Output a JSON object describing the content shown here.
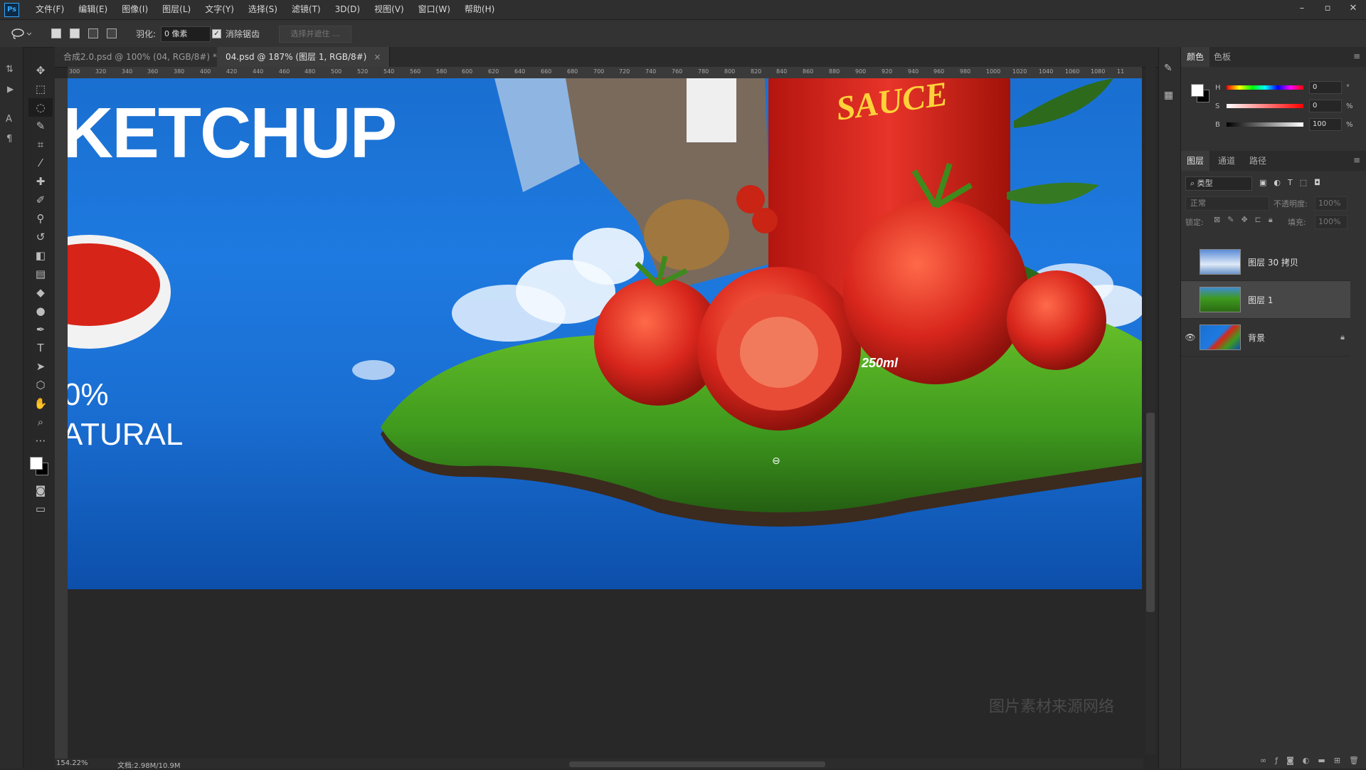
{
  "app": {
    "logo": "Ps"
  },
  "menu": [
    "文件(F)",
    "编辑(E)",
    "图像(I)",
    "图层(L)",
    "文字(Y)",
    "选择(S)",
    "滤镜(T)",
    "3D(D)",
    "视图(V)",
    "窗口(W)",
    "帮助(H)"
  ],
  "window_controls": {
    "minimize": "–",
    "restore": "▫",
    "close": "✕"
  },
  "options": {
    "feather_label": "羽化:",
    "feather_value": "0 像素",
    "antialias_label": "消除锯齿",
    "antialias_checked": true,
    "select_mask_label": "选择并遮住 ..."
  },
  "tabs": [
    {
      "label": "合成2.0.psd @ 100% (04, RGB/8#) *",
      "close": "×",
      "active": false
    },
    {
      "label": "04.psd @ 187% (图层 1, RGB/8#)",
      "close": "×",
      "active": true
    }
  ],
  "ruler": [
    "300",
    "320",
    "340",
    "360",
    "380",
    "400",
    "420",
    "440",
    "460",
    "480",
    "500",
    "520",
    "540",
    "560",
    "580",
    "600",
    "620",
    "640",
    "660",
    "680",
    "700",
    "720",
    "740",
    "760",
    "780",
    "800",
    "820",
    "840",
    "860",
    "880",
    "900",
    "920",
    "940",
    "960",
    "980",
    "1000",
    "1020",
    "1040",
    "1060",
    "1080",
    "11"
  ],
  "canvas": {
    "headline": "KETCHUP",
    "percent": "0%",
    "natural": "ATURAL",
    "package_label": "SAUCE",
    "package_size": "250ml",
    "watermark": "图片素材来源网络"
  },
  "color_panel": {
    "tabs": [
      "颜色",
      "色板"
    ],
    "rows": [
      {
        "label": "H",
        "value": "0",
        "unit": "°"
      },
      {
        "label": "S",
        "value": "0",
        "unit": "%"
      },
      {
        "label": "B",
        "value": "100",
        "unit": "%"
      }
    ]
  },
  "layers_panel": {
    "tabs": [
      "图层",
      "通道",
      "路径"
    ],
    "filter_label": "类型",
    "blend_mode": "正常",
    "opacity_label": "不透明度:",
    "opacity_value": "100%",
    "lock_label": "锁定:",
    "fill_label": "填充:",
    "fill_value": "100%",
    "layers": [
      {
        "name": "图层 30 拷贝",
        "visible": false,
        "selected": false,
        "locked": false
      },
      {
        "name": "图层 1",
        "visible": false,
        "selected": true,
        "locked": false
      },
      {
        "name": "背景",
        "visible": true,
        "selected": false,
        "locked": true
      }
    ]
  },
  "status": {
    "zoom": "154.22%",
    "doc": "文档:2.98M/10.9M"
  },
  "colors": {
    "accent": "#31a8ff",
    "sky": "#1e7ae0",
    "tomato": "#d8261c",
    "grass": "#3f9a1e"
  }
}
